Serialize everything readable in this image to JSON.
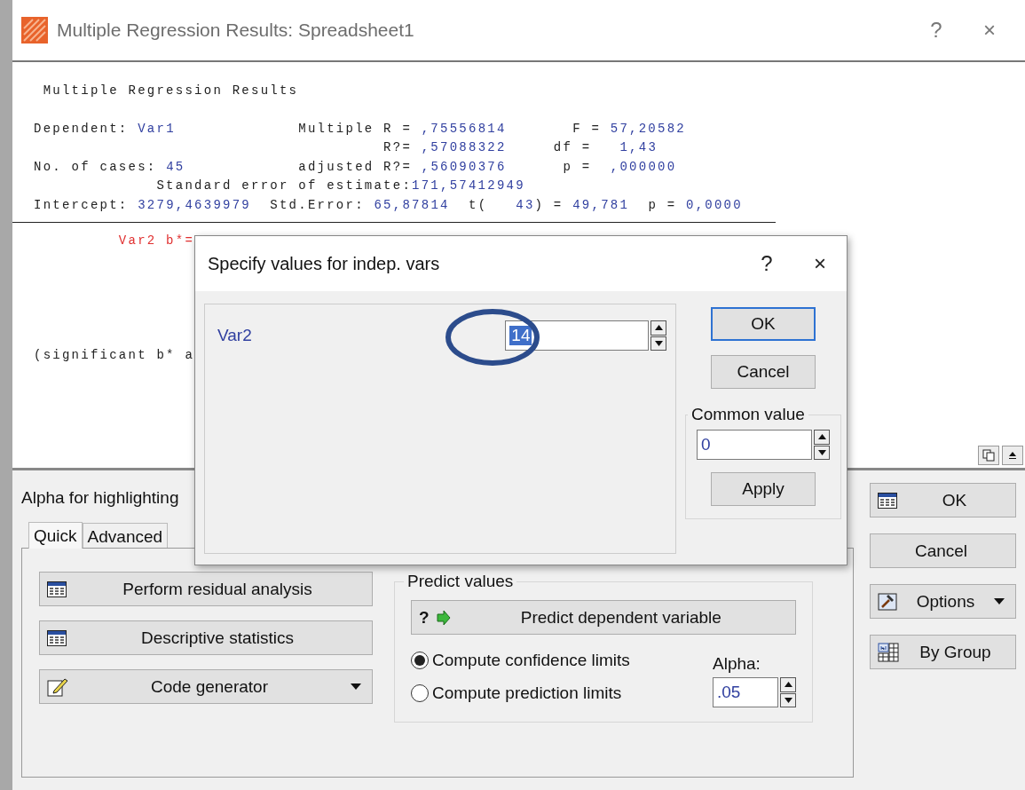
{
  "window": {
    "title": "Multiple Regression Results: Spreadsheet1",
    "help": "?",
    "close": "×"
  },
  "report": {
    "heading": " Multiple Regression Results",
    "lines": [
      [
        {
          "kind": "label",
          "text": "Dependent: "
        },
        {
          "kind": "value",
          "text": "Var1"
        },
        {
          "kind": "label",
          "text": "             Multiple R = "
        },
        {
          "kind": "value",
          "text": ",75556814"
        },
        {
          "kind": "label",
          "text": "       F = "
        },
        {
          "kind": "value",
          "text": "57,20582"
        }
      ],
      [
        {
          "kind": "label",
          "text": "                                     R?= "
        },
        {
          "kind": "value",
          "text": ",57088322"
        },
        {
          "kind": "label",
          "text": "     df =   "
        },
        {
          "kind": "value",
          "text": "1,43"
        }
      ],
      [
        {
          "kind": "label",
          "text": "No. of cases: "
        },
        {
          "kind": "value",
          "text": "45"
        },
        {
          "kind": "label",
          "text": "            adjusted R?= "
        },
        {
          "kind": "value",
          "text": ",56090376"
        },
        {
          "kind": "label",
          "text": "      p =  "
        },
        {
          "kind": "value",
          "text": ",000000"
        }
      ],
      [
        {
          "kind": "label",
          "text": "             Standard error of estimate:"
        },
        {
          "kind": "value",
          "text": "171,57412949"
        }
      ],
      [
        {
          "kind": "label",
          "text": "Intercept: "
        },
        {
          "kind": "value",
          "text": "3279,4639979"
        },
        {
          "kind": "label",
          "text": "  Std.Error: "
        },
        {
          "kind": "value",
          "text": "65,87814"
        },
        {
          "kind": "label",
          "text": "  t(   "
        },
        {
          "kind": "value",
          "text": "43"
        },
        {
          "kind": "label",
          "text": ") = "
        },
        {
          "kind": "value",
          "text": "49,781"
        },
        {
          "kind": "label",
          "text": "  p = "
        },
        {
          "kind": "value",
          "text": "0,0000"
        }
      ]
    ],
    "highlighted_row": "         Var2 b*=",
    "note": "(significant b* a"
  },
  "alpha_label": "Alpha for highlighting",
  "tabs": [
    {
      "label": "Quick",
      "selected": true
    },
    {
      "label": "Advanced",
      "selected": false
    }
  ],
  "quick_buttons": [
    {
      "label": "Perform residual analysis",
      "kind": "table",
      "dropdown": false
    },
    {
      "label": "Descriptive statistics",
      "kind": "table",
      "dropdown": false
    },
    {
      "label": "Code generator",
      "kind": "code",
      "dropdown": true
    }
  ],
  "predict": {
    "title": "Predict values",
    "button": {
      "icon_glyph": "?",
      "label": "Predict dependent variable"
    },
    "limits": [
      {
        "label": "Compute confidence limits",
        "selected": true
      },
      {
        "label": "Compute prediction limits",
        "selected": false
      }
    ],
    "alpha": {
      "label": "Alpha:",
      "value": ".05"
    }
  },
  "side_buttons": [
    {
      "label": "OK",
      "kind": "table",
      "dropdown": false
    },
    {
      "label": "Cancel",
      "kind": "none",
      "dropdown": false
    },
    {
      "label": "Options",
      "kind": "options",
      "dropdown": true
    },
    {
      "label": "By Group",
      "kind": "bygroup",
      "dropdown": false
    }
  ],
  "dialog": {
    "title": "Specify values for indep. vars",
    "help": "?",
    "close": "×",
    "variables": [
      {
        "name": "Var2",
        "value": "14",
        "highlighted": true
      }
    ],
    "buttons": [
      {
        "label": "OK",
        "default": true
      },
      {
        "label": "Cancel",
        "default": false
      }
    ],
    "common": {
      "title": "Common value",
      "value": "0",
      "apply": "Apply"
    }
  }
}
